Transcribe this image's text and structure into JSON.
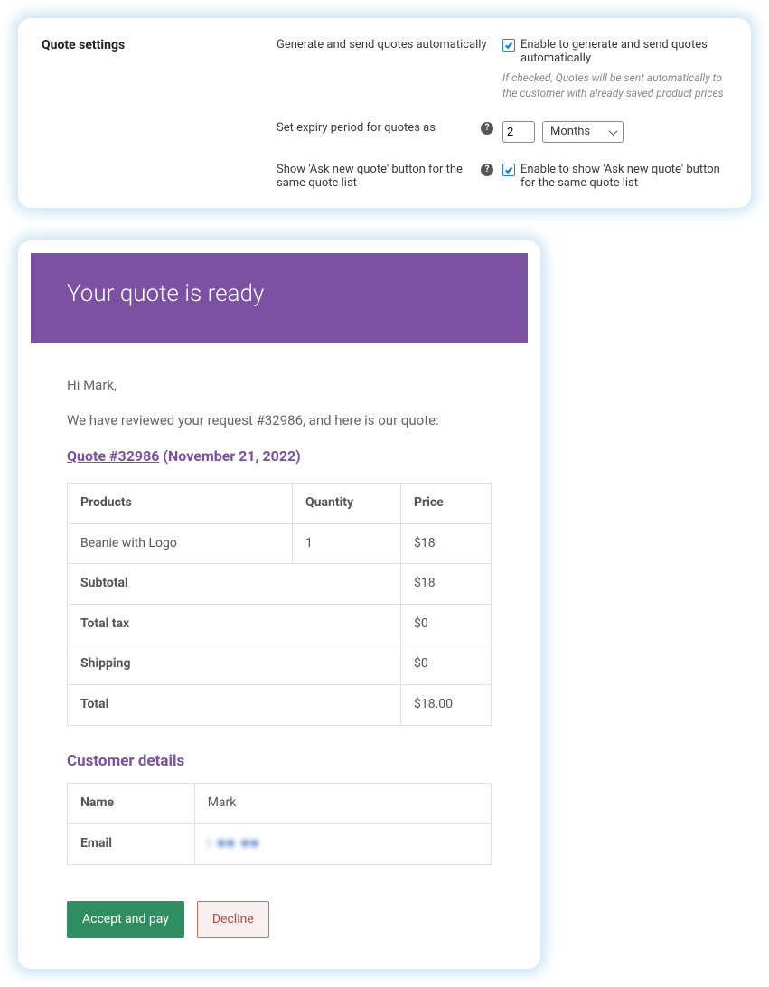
{
  "settings": {
    "section_title": "Quote settings",
    "rows": {
      "auto": {
        "label": "Generate and send quotes automatically",
        "checkbox_label": "Enable to generate and send quotes automatically",
        "hint": "If checked, Quotes will be sent automatically to the customer with already saved product prices"
      },
      "expiry": {
        "label": "Set expiry period for quotes as",
        "value": "2",
        "unit": "Months"
      },
      "ask_new": {
        "label": "Show 'Ask new quote' button for the same quote list",
        "checkbox_label": "Enable to show 'Ask new quote' button for the same quote list"
      }
    }
  },
  "email": {
    "title": "Your quote is ready",
    "greeting": "Hi Mark,",
    "intro": "We have reviewed your request #32986, and here is our quote:",
    "quote_link": "Quote #32986",
    "quote_date": "(November 21, 2022)",
    "table": {
      "headers": {
        "products": "Products",
        "quantity": "Quantity",
        "price": "Price"
      },
      "items": [
        {
          "product": "Beanie with Logo",
          "quantity": "1",
          "price": "$18"
        }
      ],
      "summary": [
        {
          "label": "Subtotal",
          "value": "$18"
        },
        {
          "label": "Total tax",
          "value": "$0"
        },
        {
          "label": "Shipping",
          "value": "$0"
        },
        {
          "label": "Total",
          "value": "$18.00"
        }
      ]
    },
    "customer_section_title": "Customer details",
    "customer": {
      "name_label": "Name",
      "name_value": "Mark",
      "email_label": "Email",
      "email_value": "i   ■■   ■■"
    },
    "buttons": {
      "accept": "Accept and pay",
      "decline": "Decline"
    }
  }
}
